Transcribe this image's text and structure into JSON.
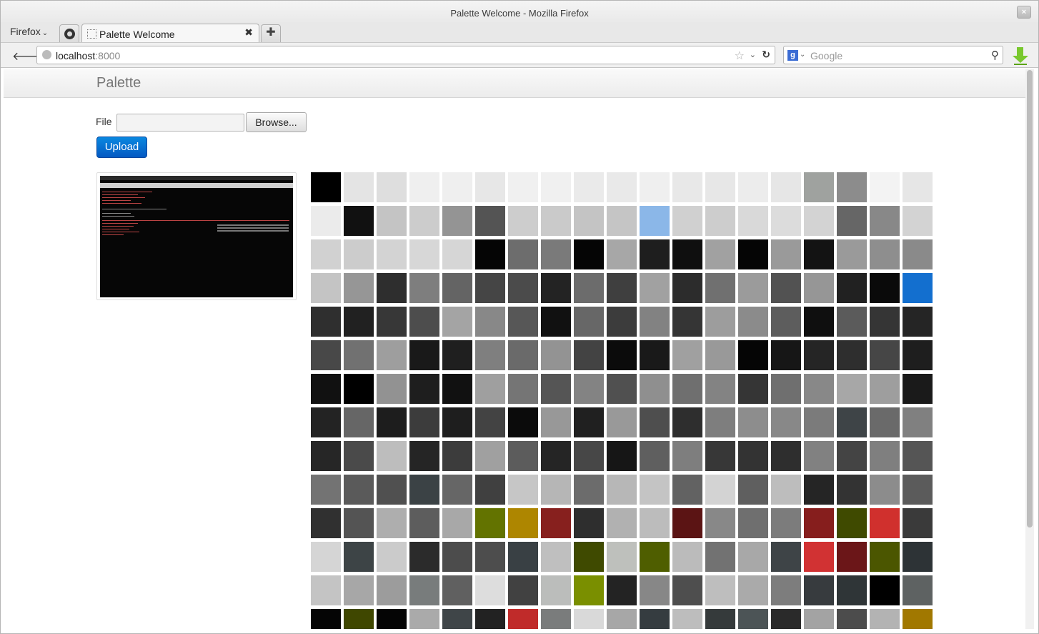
{
  "window": {
    "title": "Palette Welcome - Mozilla Firefox",
    "close_glyph": "×"
  },
  "tabbar": {
    "firefox_menu": "Firefox",
    "menu_chevron": "⌄",
    "pinned_tab_icon": "github-icon",
    "active_tab_label": "Palette Welcome",
    "close_glyph": "✖",
    "new_tab_glyph": "✚"
  },
  "navbar": {
    "back_glyph": "🡐",
    "url_host": "localhost",
    "url_port": ":8000",
    "star_glyph": "☆",
    "drop_glyph": "⌄",
    "reload_glyph": "↻",
    "search_engine_glyph": "g",
    "search_drop_glyph": "⌄",
    "search_placeholder": "Google",
    "search_glyph": "⚲"
  },
  "app": {
    "brand": "Palette",
    "file_label": "File",
    "file_value": "",
    "browse_label": "Browse...",
    "upload_label": "Upload"
  },
  "palette": [
    [
      "#000000",
      "#e4e4e4",
      "#dedede",
      "#efefef",
      "#efefef",
      "#e7e7e7",
      "#f0f0f0",
      "#f0f0f0",
      "#eaeaea",
      "#e9e9e9",
      "#efefef",
      "#e8e8e8",
      "#e7e7e7",
      "#ececec",
      "#e6e6e6",
      "#9fa29f",
      "#8c8c8c",
      "#f3f3f3",
      "#e6e6e6"
    ],
    [
      "#ebebeb",
      "#111111",
      "#c4c4c4",
      "#cccccc",
      "#949494",
      "#545454",
      "#cdcdcd",
      "#cacaca",
      "#c4c4c4",
      "#c5c5c5",
      "#8bb7e8",
      "#d0d0d0",
      "#cdcdcd",
      "#d9d9d9",
      "#dcdcdc",
      "#d3d3d3",
      "#666666",
      "#888888",
      "#d3d3d3"
    ],
    [
      "#d1d1d1",
      "#cccccc",
      "#d3d3d3",
      "#d7d7d7",
      "#d6d6d6",
      "#050505",
      "#6d6d6d",
      "#7a7a7a",
      "#050505",
      "#a7a7a7",
      "#1e1e1e",
      "#0f0f0f",
      "#a1a1a1",
      "#050505",
      "#9a9a9a",
      "#131313",
      "#9a9a9a",
      "#8e8e8e",
      "#8a8a8a"
    ],
    [
      "#c4c4c4",
      "#969696",
      "#2e2e2e",
      "#7e7e7e",
      "#646464",
      "#454545",
      "#4b4b4b",
      "#232323",
      "#6c6c6c",
      "#3f3f3f",
      "#a1a1a1",
      "#2c2c2c",
      "#707070",
      "#9b9b9b",
      "#525252",
      "#969696",
      "#212121",
      "#0a0a0a",
      "#136fcf"
    ],
    [
      "#2f2f2f",
      "#212121",
      "#373737",
      "#4d4d4d",
      "#a4a4a4",
      "#888888",
      "#575757",
      "#111111",
      "#676767",
      "#3c3c3c",
      "#828282",
      "#353535",
      "#9d9d9d",
      "#8b8b8b",
      "#5d5d5d",
      "#0f0f0f",
      "#5b5b5b",
      "#353535",
      "#252525"
    ],
    [
      "#484848",
      "#717171",
      "#9e9e9e",
      "#191919",
      "#1f1f1f",
      "#7f7f7f",
      "#6a6a6a",
      "#939393",
      "#434343",
      "#0b0b0b",
      "#191919",
      "#a0a0a0",
      "#999999",
      "#050505",
      "#161616",
      "#252525",
      "#2e2e2e",
      "#464646",
      "#1e1e1e"
    ],
    [
      "#111111",
      "#000000",
      "#929292",
      "#1e1e1e",
      "#111111",
      "#9f9f9f",
      "#757575",
      "#555555",
      "#838383",
      "#505050",
      "#8f8f8f",
      "#6f6f6f",
      "#838383",
      "#353535",
      "#6f6f6f",
      "#888888",
      "#a7a7a7",
      "#9e9e9e",
      "#1a1a1a"
    ],
    [
      "#232323",
      "#666666",
      "#1d1d1d",
      "#3c3c3c",
      "#1e1e1e",
      "#434343",
      "#0b0b0b",
      "#989898",
      "#202020",
      "#999999",
      "#4e4e4e",
      "#2e2e2e",
      "#7e7e7e",
      "#8d8d8d",
      "#888888",
      "#7b7b7b",
      "#3e4447",
      "#6a6a6a",
      "#808080"
    ],
    [
      "#262626",
      "#4a4a4a",
      "#bdbdbd",
      "#252525",
      "#3c3c3c",
      "#a0a0a0",
      "#5c5c5c",
      "#252525",
      "#474747",
      "#161616",
      "#5f5f5f",
      "#7e7e7e",
      "#373737",
      "#333333",
      "#2e2e2e",
      "#818181",
      "#444444",
      "#7f7f7f",
      "#555555"
    ],
    [
      "#737373",
      "#5a5a5a",
      "#505050",
      "#3b4245",
      "#666666",
      "#404040",
      "#c6c6c6",
      "#b6b6b6",
      "#6c6c6c",
      "#b7b7b7",
      "#c4c4c4",
      "#626262",
      "#d3d3d3",
      "#5f5f5f",
      "#bdbdbd",
      "#252525",
      "#333333",
      "#8c8c8c",
      "#5b5b5b"
    ],
    [
      "#303030",
      "#545454",
      "#aeaeae",
      "#5d5d5d",
      "#a8a8a8",
      "#637300",
      "#ae8600",
      "#87201e",
      "#2e2e2e",
      "#b1b1b1",
      "#bcbcbc",
      "#5b1414",
      "#888888",
      "#6f6f6f",
      "#7c7c7c",
      "#861e1d",
      "#3f4a00",
      "#d0302d",
      "#3a3a3a"
    ],
    [
      "#d5d5d5",
      "#3d4446",
      "#cbcbcb",
      "#2b2b2b",
      "#4c4c4c",
      "#4d4d4d",
      "#394044",
      "#bfbfbf",
      "#3f4a00",
      "#bec0bc",
      "#4f5e00",
      "#bbbbbb",
      "#727272",
      "#a8a8a8",
      "#3e4447",
      "#d13233",
      "#6b1618",
      "#4b5600",
      "#2d3336"
    ],
    [
      "#c4c4c4",
      "#a7a7a7",
      "#9c9c9c",
      "#787c7c",
      "#606060",
      "#dddddd",
      "#414141",
      "#bbbdbb",
      "#7a8f00",
      "#232323",
      "#878787",
      "#4e4e4e",
      "#bebebe",
      "#aaaaaa",
      "#7d7d7d",
      "#373b3e",
      "#2f3537",
      "#000000",
      "#5e6262"
    ],
    [
      "#050505",
      "#3f4700",
      "#050505",
      "#aaaaaa",
      "#3f4548",
      "#222222",
      "#c02b2a",
      "#7a7c7c",
      "#d9d9d9",
      "#a7a7a7",
      "#353c40",
      "#bdbdbd",
      "#353a3b",
      "#4c5456",
      "#2a2a2a",
      "#a3a3a3",
      "#4c4c4c",
      "#b3b3b3",
      "#a17800"
    ]
  ]
}
